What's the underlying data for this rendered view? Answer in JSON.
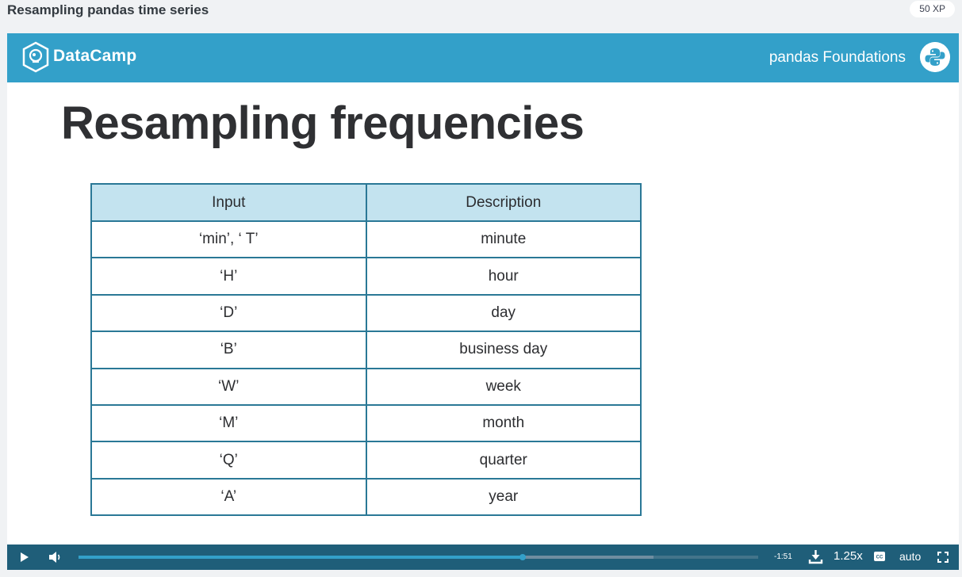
{
  "lesson": {
    "title": "Resampling pandas time series",
    "xp": "50 XP"
  },
  "slide": {
    "brand": "DataCamp",
    "course": "pandas Foundations",
    "title": "Resampling frequencies",
    "table": {
      "headers": [
        "Input",
        "Description"
      ],
      "rows": [
        [
          "‘min’, ‘ T’",
          "minute"
        ],
        [
          "‘H’",
          "hour"
        ],
        [
          "‘D’",
          "day"
        ],
        [
          "‘B’",
          "business day"
        ],
        [
          "‘W’",
          "week"
        ],
        [
          "‘M’",
          "month"
        ],
        [
          "‘Q’",
          "quarter"
        ],
        [
          "‘A’",
          "year"
        ]
      ]
    }
  },
  "player": {
    "time_remaining": "-1:51",
    "speed": "1.25x",
    "quality": "auto",
    "progress_fraction": 0.653,
    "buffered_fraction": 0.846
  },
  "icons": {
    "play": "play-icon",
    "volume": "volume-icon",
    "download": "download-icon",
    "captions": "captions-icon",
    "fullscreen": "fullscreen-icon",
    "logo": "datacamp-logo-icon",
    "course": "python-logo-icon"
  },
  "colors": {
    "header": "#33a0c9",
    "table_header": "#c3e3ef",
    "table_border": "#2a7896",
    "controls": "#1f5e79"
  }
}
